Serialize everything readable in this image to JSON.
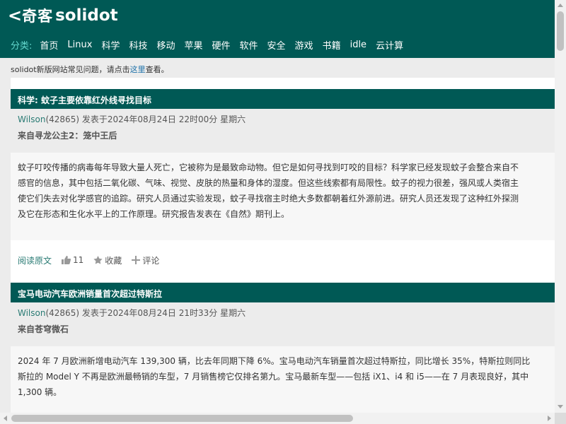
{
  "logo": {
    "bracket": "<",
    "cn": "奇客",
    "en": "solidot"
  },
  "nav": {
    "label": "分类:",
    "items": [
      "首页",
      "Linux",
      "科学",
      "科技",
      "移动",
      "苹果",
      "硬件",
      "软件",
      "安全",
      "游戏",
      "书籍",
      "idle",
      "云计算"
    ]
  },
  "notice": {
    "before": "solidot新版网站常见问题，请点击",
    "link": "这里",
    "after": "查看。"
  },
  "articles": [
    {
      "title": "科学: 蚊子主要依靠红外线寻找目标",
      "author": "Wilson",
      "author_count": "(42865)",
      "posted": "发表于2024年08月24日 22时00分 星期六",
      "from": "来自寻龙公主2：笼中王后",
      "body": [
        "蚊子叮咬传播的病毒每年导致大量人死亡，它被称为是最致命动物。但它是如何寻找到叮咬的目标？科学家已经发现蚊子会整合来自不",
        "感官的信息，其中包括二氧化碳、气味、视觉、皮肤的热量和身体的湿度。但这些线索都有局限性。蚊子的视力很差，强风或人类宿主",
        "使它们失去对化学感官的追踪。研究人员通过实验发现，蚊子寻找宿主时绝大多数都朝着红外源前进。研究人员还发现了这种红外探测",
        "及它在形态和生化水平上的工作原理。研究报告发表在《自然》期刊上。"
      ],
      "actions": {
        "read": "阅读原文",
        "likes": "11",
        "fav": "收藏",
        "comment": "评论"
      }
    },
    {
      "title": "宝马电动汽车欧洲销量首次超过特斯拉",
      "author": "Wilson",
      "author_count": "(42865)",
      "posted": "发表于2024年08月24日 21时33分 星期六",
      "from": "来自苍穹微石",
      "body": [
        "2024 年 7 月欧洲新增电动汽车 139,300 辆，比去年同期下降 6%。宝马电动汽车销量首次超过特斯拉，同比增长 35%，特斯拉则同比",
        "斯拉的 Model Y 不再是欧洲最畅销的车型，7 月销售榜它仅排名第九。宝马最新车型——包括 iX1、i4 和 i5——在 7 月表现良好，其中",
        "1,300 辆。"
      ]
    }
  ]
}
